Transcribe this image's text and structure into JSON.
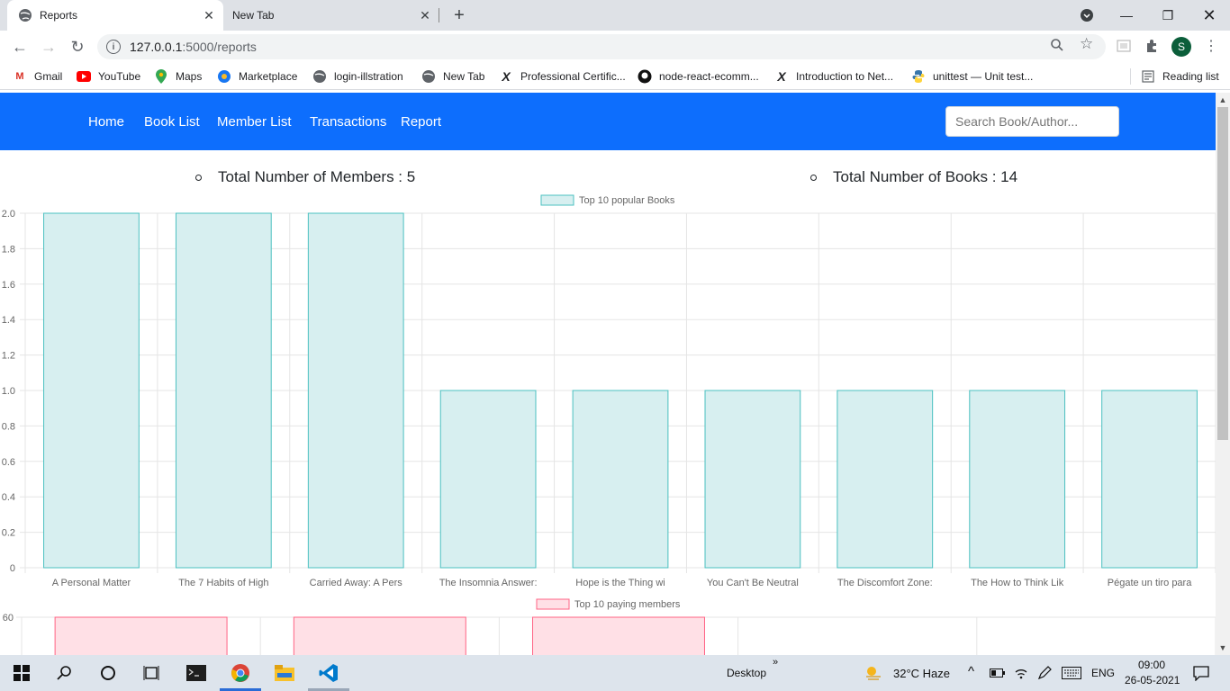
{
  "browser": {
    "tabs": [
      {
        "title": "Reports"
      },
      {
        "title": "New Tab"
      }
    ],
    "url_host": "127.0.0.1",
    "url_path": ":5000/reports",
    "reading_list": "Reading list",
    "profile_initial": "S",
    "bookmarks": [
      "Gmail",
      "YouTube",
      "Maps",
      "Marketplace",
      "login-illstration",
      "New Tab",
      "Professional Certific...",
      "node-react-ecomm...",
      "Introduction to Net...",
      "unittest — Unit test..."
    ]
  },
  "navbar": {
    "links": [
      "Home",
      "Book List",
      "Member List",
      "Transactions",
      "Report"
    ],
    "search_placeholder": "Search Book/Author..."
  },
  "stats": {
    "members_label": "Total Number of Members : 5",
    "books_label": "Total Number of Books : 14"
  },
  "chart_data": [
    {
      "type": "bar",
      "legend": "Top 10 popular Books",
      "categories": [
        "A Personal Matter",
        "The 7 Habits of High",
        "Carried Away: A Pers",
        "The Insomnia Answer:",
        "Hope is the Thing wi",
        "You Can't Be Neutral",
        "The Discomfort Zone:",
        "The How to Think Lik",
        "Pégate un tiro para"
      ],
      "values": [
        2,
        2,
        2,
        1,
        1,
        1,
        1,
        1,
        1
      ],
      "ylim": [
        0,
        2
      ],
      "yticks": [
        "2.0",
        "1.8",
        "1.6",
        "1.4",
        "1.2",
        "1.0",
        "0.8",
        "0.6",
        "0.4",
        "0.2",
        "0"
      ],
      "colors": {
        "fill": "#d7eff0",
        "stroke": "#4bc0c0"
      },
      "grid": true
    },
    {
      "type": "bar",
      "legend": "Top 10 paying members",
      "values": [
        60,
        60,
        60
      ],
      "visible_ytick": "60",
      "colors": {
        "fill": "#ffe0e6",
        "stroke": "#ff6384"
      },
      "grid": true
    }
  ],
  "taskbar": {
    "desktop_label": "Desktop",
    "weather": "32°C  Haze",
    "language": "ENG",
    "time": "09:00",
    "date": "26-05-2021"
  }
}
